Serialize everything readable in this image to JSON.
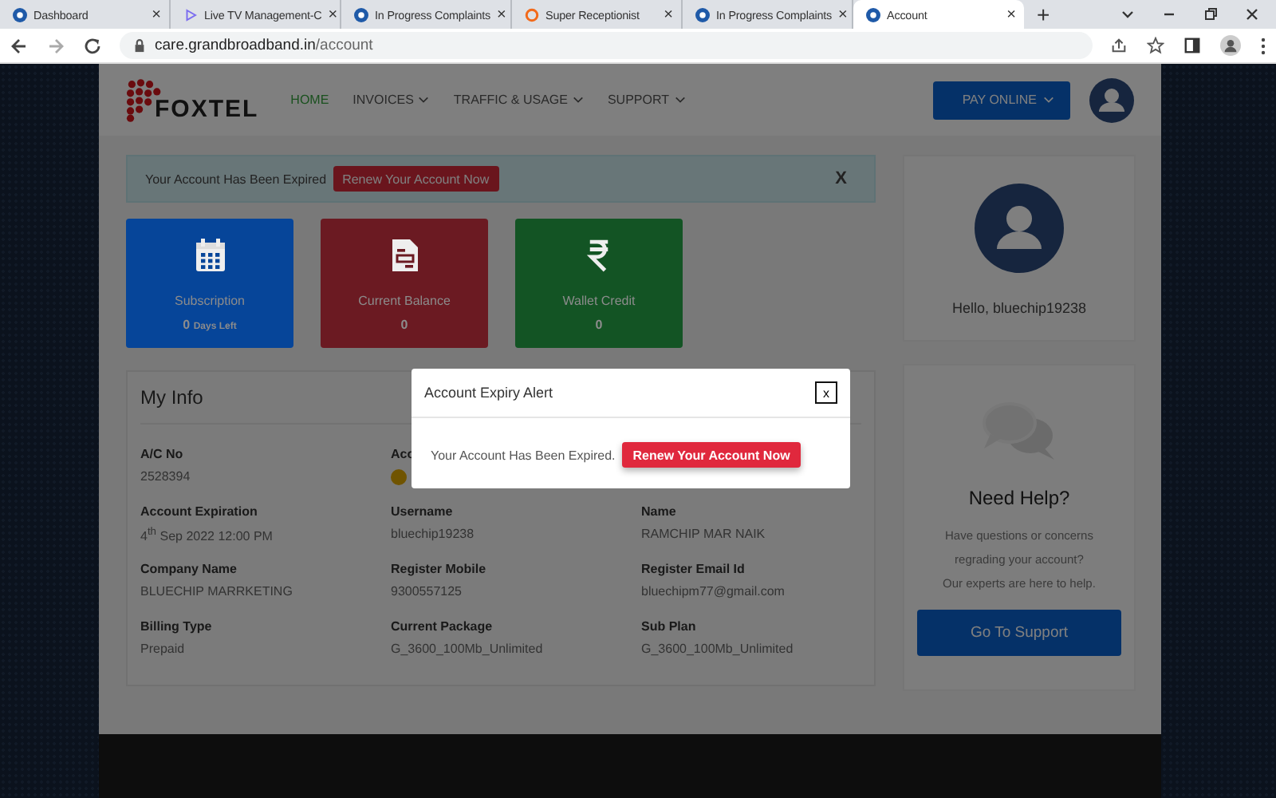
{
  "browser": {
    "tabs": [
      {
        "title": "Dashboard",
        "kind": "logo",
        "selected": false
      },
      {
        "title": "Live TV Management-C",
        "kind": "play",
        "selected": false
      },
      {
        "title": "In Progress Complaints",
        "kind": "logo",
        "selected": false
      },
      {
        "title": "Super Receptionist",
        "kind": "ring",
        "selected": false
      },
      {
        "title": "In Progress Complaints",
        "kind": "logo",
        "selected": false
      },
      {
        "title": "Account",
        "kind": "logo",
        "selected": true
      }
    ],
    "new_tab": "+",
    "close": "×",
    "url_host": "care.grandbroadband.in",
    "url_path": "/account"
  },
  "header": {
    "logo": "FOXTEL",
    "nav": [
      {
        "label": "HOME",
        "selected": true,
        "dropdown": false
      },
      {
        "label": "INVOICES",
        "selected": false,
        "dropdown": true
      },
      {
        "label": "TRAFFIC & USAGE",
        "selected": false,
        "dropdown": true
      },
      {
        "label": "SUPPORT",
        "selected": false,
        "dropdown": true
      }
    ],
    "pay_button": "PAY ONLINE"
  },
  "alert": {
    "message": "Your Account Has Been Expired",
    "button": "Renew Your Account Now",
    "close": "X"
  },
  "stats": [
    {
      "kind": "calendar",
      "color": "#064599",
      "title": "Subscription",
      "value": "0",
      "unit": "Days Left"
    },
    {
      "kind": "document",
      "color": "#6b1a22",
      "title": "Current Balance",
      "value": "0"
    },
    {
      "kind": "rupee",
      "color": "#135424",
      "title": "Wallet Credit",
      "value": "0"
    }
  ],
  "my_info": {
    "title": "My Info",
    "fields": [
      {
        "label": "A/C No",
        "value": "2528394"
      },
      {
        "label": "Acc"
      },
      {
        "label": "Account Expiration",
        "value": "4$^{th}$ Sep 2022 12:00 PM"
      },
      {
        "label": "Username",
        "value": "bluechip19238"
      },
      {
        "label": "Name",
        "value": "RAMCHIP MAR NAIK"
      },
      {
        "label": "Company Name",
        "value": "BLUECHIP MARRKETING"
      },
      {
        "label": "Register Mobile",
        "value": "9300557125"
      },
      {
        "label": "Register Email Id",
        "value": "bluechipm77@gmail.com"
      },
      {
        "label": "Billing Type",
        "value": "Prepaid"
      },
      {
        "label": "Current Package",
        "value": "G_3600_100Mb_Unlimited"
      },
      {
        "label": "Sub Plan",
        "value": "G_3600_100Mb_Unlimited"
      }
    ]
  },
  "profile": {
    "greeting": "Hello, bluechip19238"
  },
  "help": {
    "title": "Need Help?",
    "lines": [
      "Have questions or concerns",
      "regrading your account?",
      "Our experts are here to help."
    ],
    "button": "Go To Support"
  },
  "modal": {
    "title": "Account Expiry Alert",
    "close": "x",
    "message": "Your Account Has Been Expired.",
    "button": "Renew Your Account Now"
  }
}
